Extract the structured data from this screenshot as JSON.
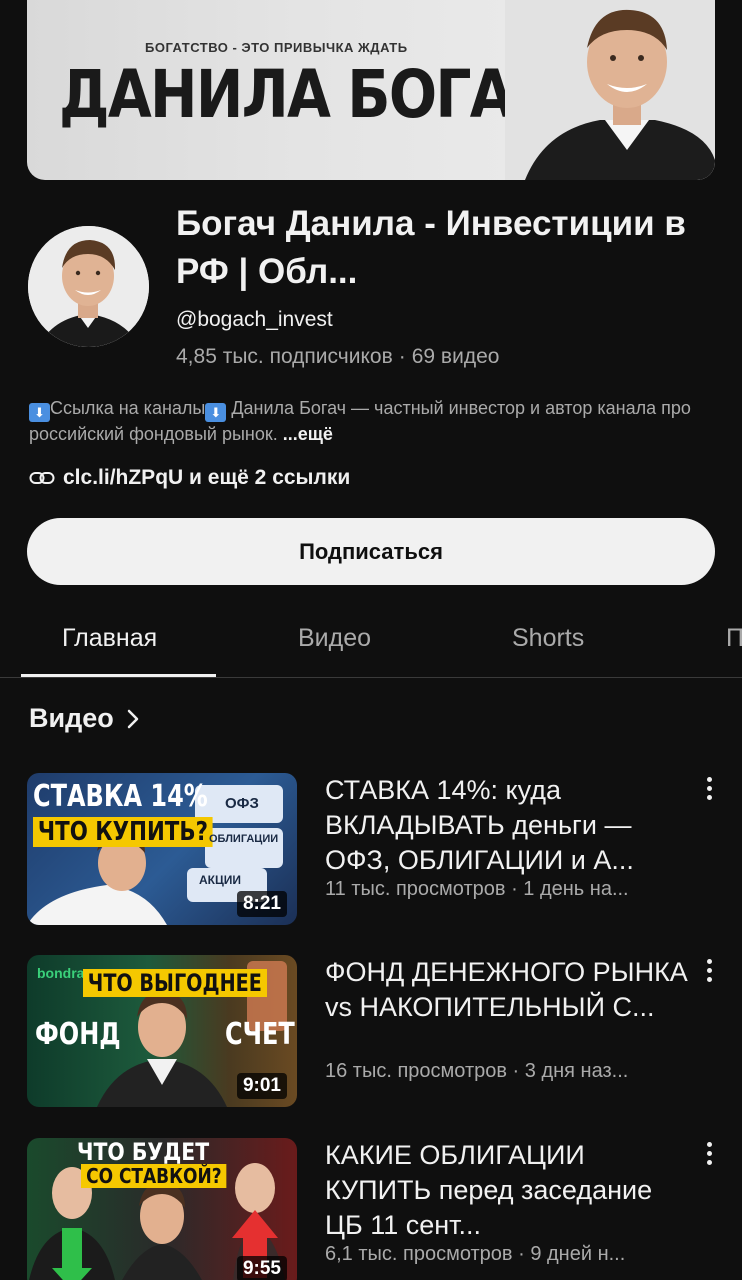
{
  "banner": {
    "tagline": "БОГАТСТВО - ЭТО ПРИВЫЧКА ЖДАТЬ",
    "title": "ДАНИЛА БОГАЧ"
  },
  "channel": {
    "name": "Богач Данила - Инвестиции в РФ | Обл...",
    "handle": "@bogach_invest",
    "subscribers": "4,85 тыс. подписчиков",
    "videos_count": "69 видео",
    "description_part1": "Ссылка на каналы",
    "description_part2": " Данила Богач — частный инвестор и автор канала про российский фондовый рынок. ",
    "description_more": "...ещё",
    "links": "clc.li/hZPqU и ещё 2 ссылки",
    "subscribe_label": "Подписаться"
  },
  "tabs": [
    {
      "label": "Главная",
      "active": true
    },
    {
      "label": "Видео",
      "active": false
    },
    {
      "label": "Shorts",
      "active": false
    },
    {
      "label": "П",
      "active": false
    }
  ],
  "section": {
    "title": "Видео"
  },
  "videos": [
    {
      "title": "СТАВКА 14%: куда ВКЛАДЫВАТЬ деньги — ОФЗ, ОБЛИГАЦИИ и А...",
      "meta": "11 тыс. просмотров · 1 день на...",
      "duration": "8:21",
      "thumb_top": "СТАВКА 14%",
      "thumb_mid": "ЧТО КУПИТЬ?",
      "thumb_card1": "ОФЗ",
      "thumb_card2": "ОБЛИГАЦИИ",
      "thumb_card3": "АКЦИИ"
    },
    {
      "title": "ФОНД ДЕНЕЖНОГО РЫНКА vs НАКОПИТЕЛЬНЫЙ С...",
      "meta": "16 тыс. просмотров · 3 дня наз...",
      "duration": "9:01",
      "thumb_top": "ЧТО ВЫГОДНЕЕ",
      "thumb_left": "ФОНД",
      "thumb_right": "СЧЕТ",
      "thumb_brand": "bondra"
    },
    {
      "title": "КАКИЕ ОБЛИГАЦИИ КУПИТЬ перед заседание ЦБ 11 сент...",
      "meta": "6,1 тыс. просмотров · 9 дней н...",
      "duration": "9:55",
      "thumb_top": "ЧТО БУДЕТ",
      "thumb_mid": "СО СТАВКОЙ?"
    }
  ],
  "colors": {
    "background": "#0f0f0f",
    "text_primary": "#f1f1f1",
    "text_secondary": "#aaaaaa",
    "button_bg": "#f1f1f1",
    "thumb_yellow": "#f5c800"
  }
}
